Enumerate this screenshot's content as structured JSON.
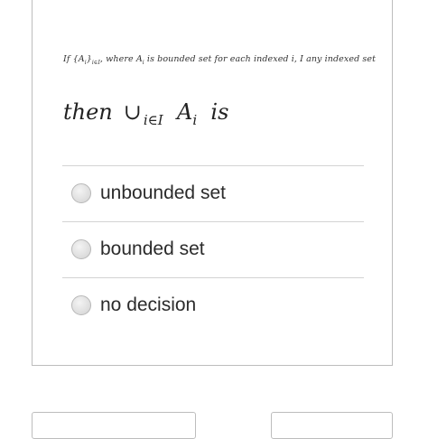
{
  "question": {
    "line1": {
      "text_a": "If {A",
      "sub_a": "i",
      "text_b": "}",
      "sub_b": "i∈I",
      "text_c": ", where A",
      "sub_c": "i",
      "text_d": " is bounded set for each indexed i, I any indexed set"
    },
    "line2": {
      "then": "then",
      "union": "∪",
      "union_sub": "i∈I",
      "a": "A",
      "a_sub": "i",
      "is": "is"
    }
  },
  "options": [
    {
      "label": "unbounded set"
    },
    {
      "label": "bounded set"
    },
    {
      "label": "no decision"
    }
  ],
  "colors": {
    "border": "#bdbdbd",
    "divider": "#d3d3d3",
    "radio_fill": "#dcdcdc",
    "text": "#2b2b2b"
  }
}
